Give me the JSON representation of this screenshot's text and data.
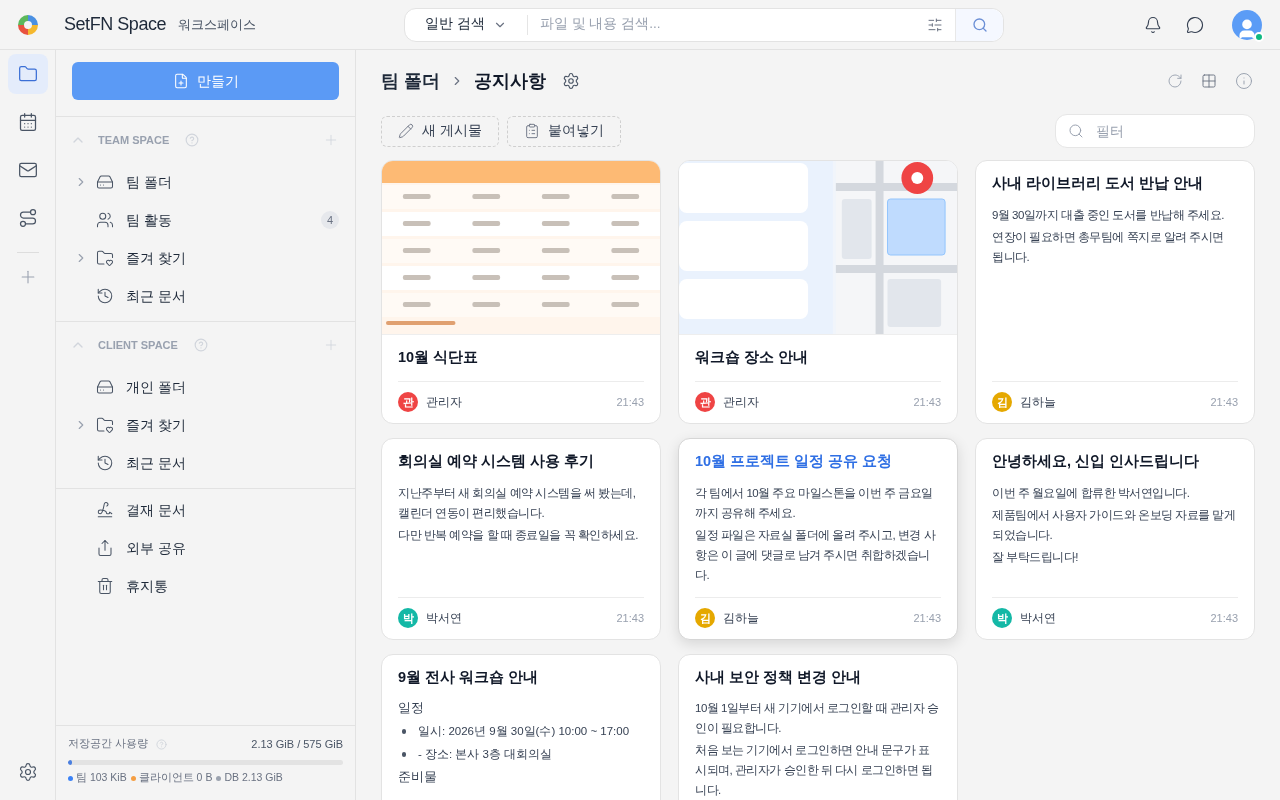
{
  "header": {
    "brand": "SetFN Space",
    "workspace": "워크스페이스",
    "search": {
      "mode": "일반 검색",
      "placeholder": "파일 및 내용 검색..."
    },
    "user": {
      "online": true
    }
  },
  "rail": [
    {
      "kind": "folder",
      "selected": true
    },
    {
      "kind": "calendar",
      "selected": false
    },
    {
      "kind": "mail",
      "selected": false
    },
    {
      "kind": "route",
      "selected": false
    }
  ],
  "sidebar": {
    "create_button": "만들기",
    "sections": [
      {
        "title": "TEAM SPACE",
        "expanded": true,
        "items": [
          {
            "kind": "drive",
            "label": "팀 폴더",
            "expanded": false
          },
          {
            "kind": "team",
            "label": "팀 활동",
            "count": "4"
          },
          {
            "kind": "favorites",
            "label": "즐겨 찾기",
            "expanded": false
          },
          {
            "kind": "recent",
            "label": "최근 문서"
          }
        ]
      },
      {
        "title": "CLIENT SPACE",
        "expanded": true,
        "items": [
          {
            "kind": "drive",
            "label": "개인 폴더"
          },
          {
            "kind": "favorites",
            "label": "즐겨 찾기",
            "expanded": false
          },
          {
            "kind": "recent",
            "label": "최근 문서"
          }
        ]
      }
    ],
    "extra_items": [
      {
        "kind": "signature",
        "label": "결재 문서"
      },
      {
        "kind": "share",
        "label": "외부 공유"
      },
      {
        "kind": "trash",
        "label": "휴지통"
      }
    ],
    "storage": {
      "label": "저장공간 사용량",
      "value": "2.13 GiB / 575 GiB",
      "level": 0.01,
      "legend": [
        {
          "label": "팀 103 KiB",
          "color": "#3b82f6"
        },
        {
          "label": "클라이언트 0 B",
          "color": "#f59e42"
        },
        {
          "label": "DB 2.13 GiB",
          "color": "#9ca3af"
        }
      ]
    }
  },
  "breadcrumb": [
    "팀 폴더",
    "공지사항"
  ],
  "toolbar": {
    "buttons": [
      {
        "kind": "write",
        "label": "새 게시물"
      },
      {
        "kind": "paste",
        "label": "붙여넣기"
      }
    ],
    "filter_placeholder": "필터"
  },
  "cards": [
    {
      "title": "10월 식단표",
      "highlighted": false,
      "author": "관리자",
      "initial": "관",
      "color": "#ef4444",
      "time": "21:43"
    },
    {
      "title": "워크숍 장소 안내",
      "highlighted": false,
      "author": "관리자",
      "initial": "관",
      "color": "#ef4444",
      "time": "21:43"
    },
    {
      "title": "사내 라이브러리 도서 반납 안내",
      "highlighted": false,
      "body": [
        {
          "kind": "paragraph",
          "text": "9월 30일까지 대출 중인 도서를 반납해 주세요."
        },
        {
          "kind": "paragraph",
          "text": "연장이 필요하면 총무팀에 쪽지로 알려 주시면 됩니다."
        }
      ],
      "author": "김하늘",
      "initial": "김",
      "color": "#e5a800",
      "time": "21:43"
    },
    {
      "title": "회의실 예약 시스템 사용 후기",
      "highlighted": false,
      "body": [
        {
          "kind": "paragraph",
          "text": "지난주부터 새 회의실 예약 시스템을 써 봤는데, 캘린더 연동이 편리했습니다."
        },
        {
          "kind": "paragraph",
          "text": "다만 반복 예약을 할 때 종료일을 꼭 확인하세요."
        }
      ],
      "author": "박서연",
      "initial": "박",
      "color": "#14b8a6",
      "time": "21:43"
    },
    {
      "title": "10월 프로젝트 일정 공유 요청",
      "highlighted": true,
      "body": [
        {
          "kind": "paragraph",
          "text": "각 팀에서 10월 주요 마일스톤을 이번 주 금요일까지 공유해 주세요."
        },
        {
          "kind": "paragraph",
          "text": "일정 파일은 자료실 폴더에 올려 주시고, 변경 사항은 이 글에 댓글로 남겨 주시면 취합하겠습니다."
        }
      ],
      "author": "김하늘",
      "initial": "김",
      "color": "#e5a800",
      "time": "21:43"
    },
    {
      "title": "안녕하세요, 신입 인사드립니다",
      "highlighted": false,
      "body": [
        {
          "kind": "paragraph",
          "text": "이번 주 월요일에 합류한 박서연입니다."
        },
        {
          "kind": "paragraph",
          "text": "제품팀에서 사용자 가이드와 온보딩 자료를 맡게 되었습니다."
        },
        {
          "kind": "paragraph",
          "text": "잘 부탁드립니다!"
        }
      ],
      "author": "박서연",
      "initial": "박",
      "color": "#14b8a6",
      "time": "21:43"
    },
    {
      "title": "9월 전사 워크숍 안내",
      "highlighted": false,
      "body": [
        {
          "kind": "heading",
          "text": "일정"
        },
        {
          "kind": "bullet",
          "text": "일시: 2026년 9월 30일(수) 10:00 ~ 17:00"
        },
        {
          "kind": "bullet",
          "text": "- 장소: 본사 3층 대회의실"
        },
        {
          "kind": "heading",
          "text": "준비물"
        }
      ]
    },
    {
      "title": "사내 보안 정책 변경 안내",
      "highlighted": false,
      "body": [
        {
          "kind": "paragraph",
          "text": "10월 1일부터 새 기기에서 로그인할 때 관리자 승인이 필요합니다."
        },
        {
          "kind": "paragraph",
          "text": "처음 보는 기기에서 로그인하면 안내 문구가 표시되며, 관리자가 승인한 뒤 다시 로그인하면 됩니다."
        }
      ]
    }
  ]
}
